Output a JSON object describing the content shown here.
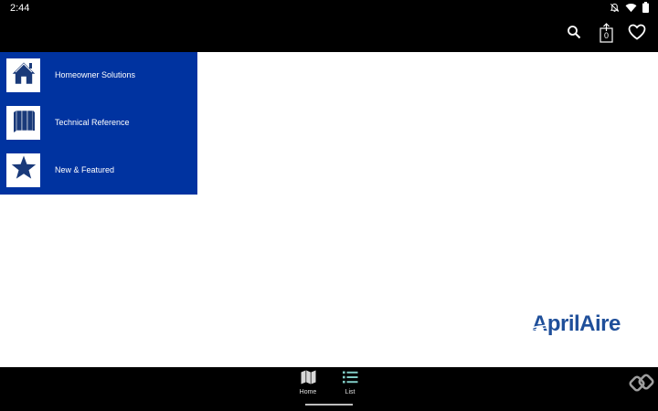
{
  "status_bar": {
    "time": "2:44",
    "icons": [
      "mute-icon",
      "wifi-icon",
      "battery-icon"
    ]
  },
  "toolbar": {
    "cart_count": "0",
    "icons": [
      "search-icon",
      "cart-icon",
      "heart-icon"
    ]
  },
  "menu": {
    "background": "#0033a0",
    "items": [
      {
        "label": "Homeowner Solutions",
        "icon": "house-icon"
      },
      {
        "label": "Technical Reference",
        "icon": "books-icon"
      },
      {
        "label": "New & Featured",
        "icon": "star-icon"
      }
    ]
  },
  "brand": {
    "logo_text": "AprilAire",
    "color": "#1f4f9a"
  },
  "bottom_nav": {
    "items": [
      {
        "label": "Home",
        "icon": "map-icon"
      },
      {
        "label": "List",
        "icon": "list-icon",
        "selected": true
      }
    ],
    "accent": "#80cbc4"
  }
}
